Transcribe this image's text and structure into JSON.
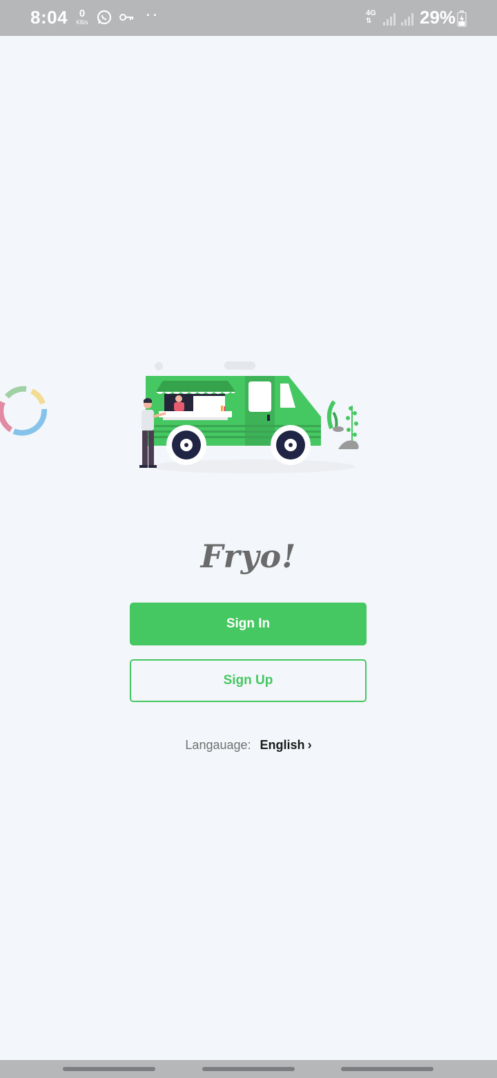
{
  "status_bar": {
    "time": "8:04",
    "speed_value": "0",
    "speed_unit": "KB/s",
    "network": "4G",
    "battery": "29%",
    "icons": [
      "whatsapp-icon",
      "key-icon",
      "more-dots-icon",
      "signal-icon",
      "battery-charging-icon"
    ]
  },
  "app": {
    "logo_text": "Fryo!",
    "sign_in_label": "Sign In",
    "sign_up_label": "Sign Up",
    "language_label": "Langauage:",
    "language_value": "English",
    "language_chevron": "›"
  },
  "colors": {
    "accent": "#45c761",
    "background": "#f3f6fa",
    "system_bar": "#b6b7b9"
  }
}
